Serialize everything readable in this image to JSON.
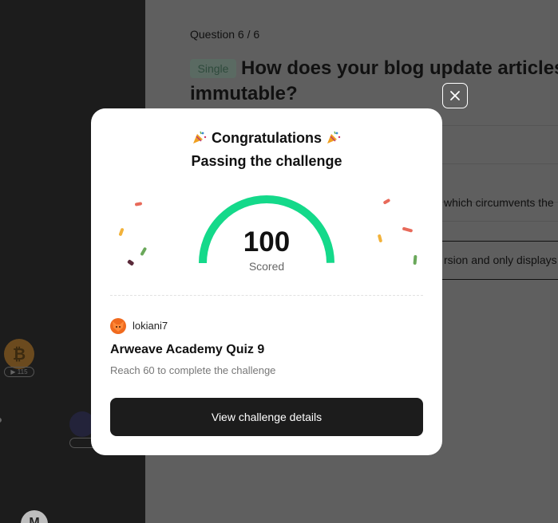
{
  "background": {
    "sidebar": {
      "coins": [
        {
          "name": "bitcoin",
          "symbol": "₿",
          "badge": "▶ 115"
        },
        {
          "name": "coin-2"
        },
        {
          "name": "coin-m",
          "symbol": "M"
        }
      ]
    },
    "quiz": {
      "counter": "Question 6 / 6",
      "tag": "Single",
      "question": "How does your blog update articles is immutable?",
      "options": [
        {
          "text": ""
        },
        {
          "text": ""
        },
        {
          "text": "which circumvents the"
        },
        {
          "text": "rsion and only displays"
        }
      ]
    }
  },
  "modal": {
    "close_icon": "close-icon",
    "title": "Congratulations",
    "title_icon": "party-popper-icon",
    "subtitle": "Passing the challenge",
    "score": "100",
    "score_label": "Scored",
    "score_fraction": 1.0,
    "user": {
      "name": "lokiani7",
      "avatar_icon": "fox-avatar"
    },
    "quiz_title": "Arweave Academy Quiz 9",
    "quiz_description": "Reach 60 to complete the challenge",
    "button_label": "View challenge details"
  },
  "colors": {
    "gauge": "#14d98a",
    "button": "#1c1c1c",
    "overlay_left": "#1c1c1c",
    "overlay_right": "#5f5f5f"
  }
}
